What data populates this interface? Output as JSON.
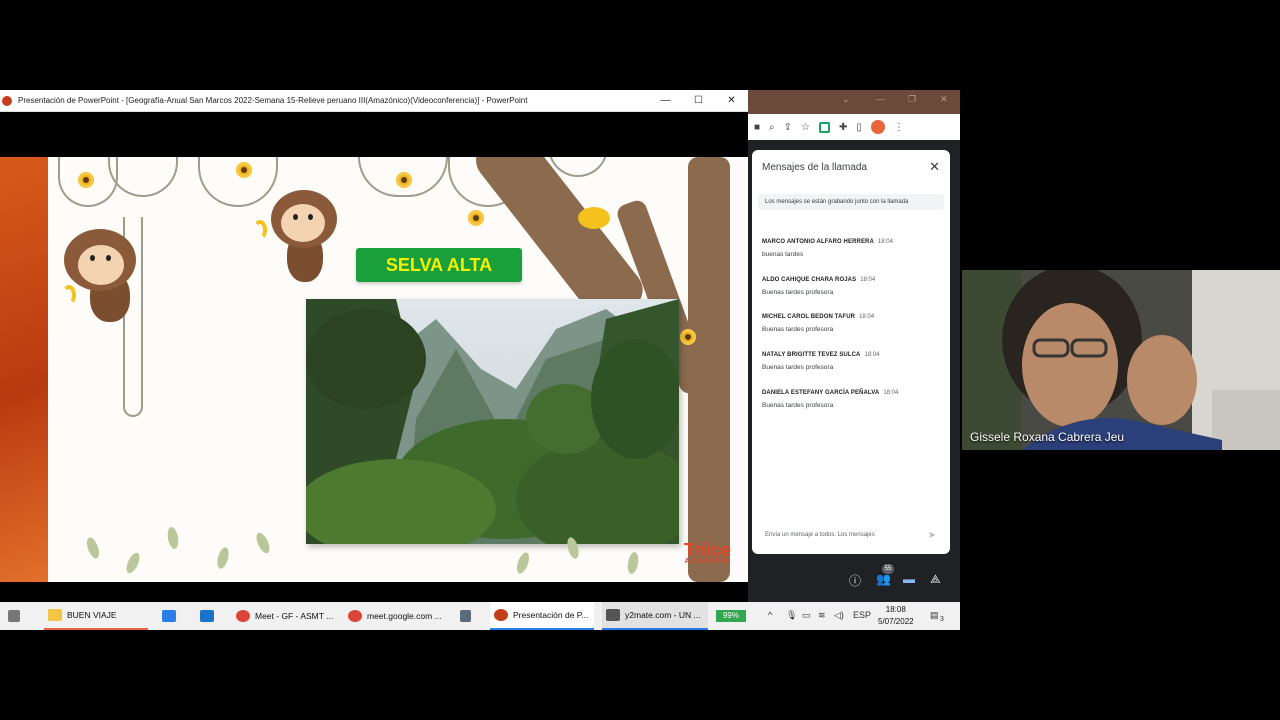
{
  "ppt_window": {
    "title": "Presentación de PowerPoint - [Geografía-Anual San Marcos 2022-Semana 15-Relieve peruano III(Amazónico)(Videoconferencia)] - PowerPoint",
    "minimize": "—",
    "maximize": "☐",
    "close": "✕"
  },
  "slide": {
    "title": "SELVA ALTA",
    "logo_main": "Trilce",
    "logo_sub": "ACADEMIA"
  },
  "chat": {
    "title": "Mensajes de la llamada",
    "close": "✕",
    "notice": "Los mensajes se están grabando junto con la llamada",
    "messages": [
      {
        "name": "MARCO ANTONIO ALFARO HERRERA",
        "time": "18:04",
        "text": "buenas tardes"
      },
      {
        "name": "ALDO CAHIQUE CHARA ROJAS",
        "time": "18:04",
        "text": "Buenas tardes profesora"
      },
      {
        "name": "MICHEL CAROL BEDON TAFUR",
        "time": "18:04",
        "text": "Buenas tardes profesora"
      },
      {
        "name": "NATALY BRIGITTE TEVEZ SULCA",
        "time": "18:04",
        "text": "Buenas tardes profesora"
      },
      {
        "name": "DANIELA ESTEFANY GARCÍA PEÑALVA",
        "time": "18:04",
        "text": "Buenas tardes profesora"
      }
    ],
    "input_placeholder": "Envía un mensaje a todos. Los mensajes"
  },
  "meet_controls": {
    "people_count": "55"
  },
  "video": {
    "participant_name": "Gissele Roxana Cabrera Jeu"
  },
  "taskbar": {
    "items": [
      {
        "label": "BUEN VIAJE",
        "icon": "folder-icon",
        "color": "#f4c542"
      },
      {
        "label": "Meet - GF - ASMT ...",
        "icon": "chrome-icon",
        "color": "#db4437"
      },
      {
        "label": "meet.google.com ...",
        "icon": "chrome-icon",
        "color": "#db4437"
      },
      {
        "label": "Presentación de P...",
        "icon": "powerpoint-icon",
        "color": "#c43e1c"
      },
      {
        "label": "y2mate.com - UN ...",
        "icon": "browser-icon",
        "color": "#555555"
      }
    ],
    "battery": "99%",
    "language": "ESP",
    "time": "18:08",
    "date": "5/07/2022",
    "notifications": "3"
  }
}
